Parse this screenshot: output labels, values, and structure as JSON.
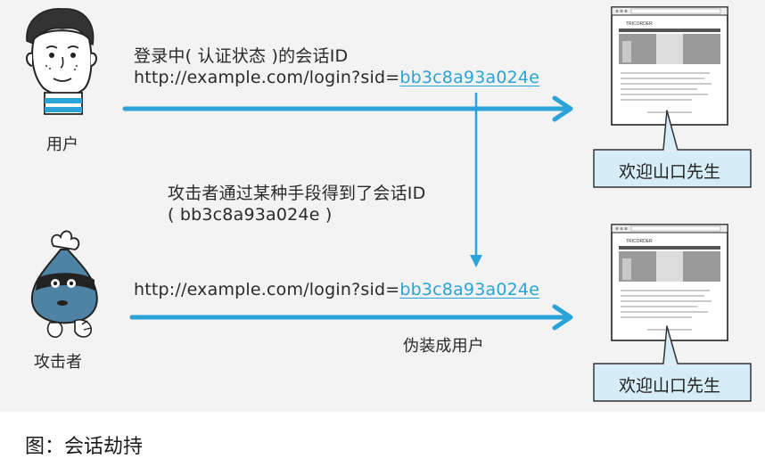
{
  "actors": {
    "user_label": "用户",
    "attacker_label": "攻击者"
  },
  "messages": {
    "login_label": "登录中( 认证状态 )的会话ID",
    "url_prefix": "http://example.com/login?sid=",
    "session_id": "bb3c8a93a024e",
    "steal_line1": "攻击者通过某种手段得到了会话ID",
    "steal_line2": "( bb3c8a93a024e )",
    "impersonate": "伪装成用户"
  },
  "browser": {
    "site_name": "TRICORDER"
  },
  "balloons": {
    "top": "欢迎山口先生",
    "bottom": "欢迎山口先生"
  },
  "caption": "图：会话劫持",
  "colors": {
    "arrow": "#2aa3d8",
    "balloon_bg": "#d6ecf7",
    "panel_bg": "#f3f3f3"
  }
}
